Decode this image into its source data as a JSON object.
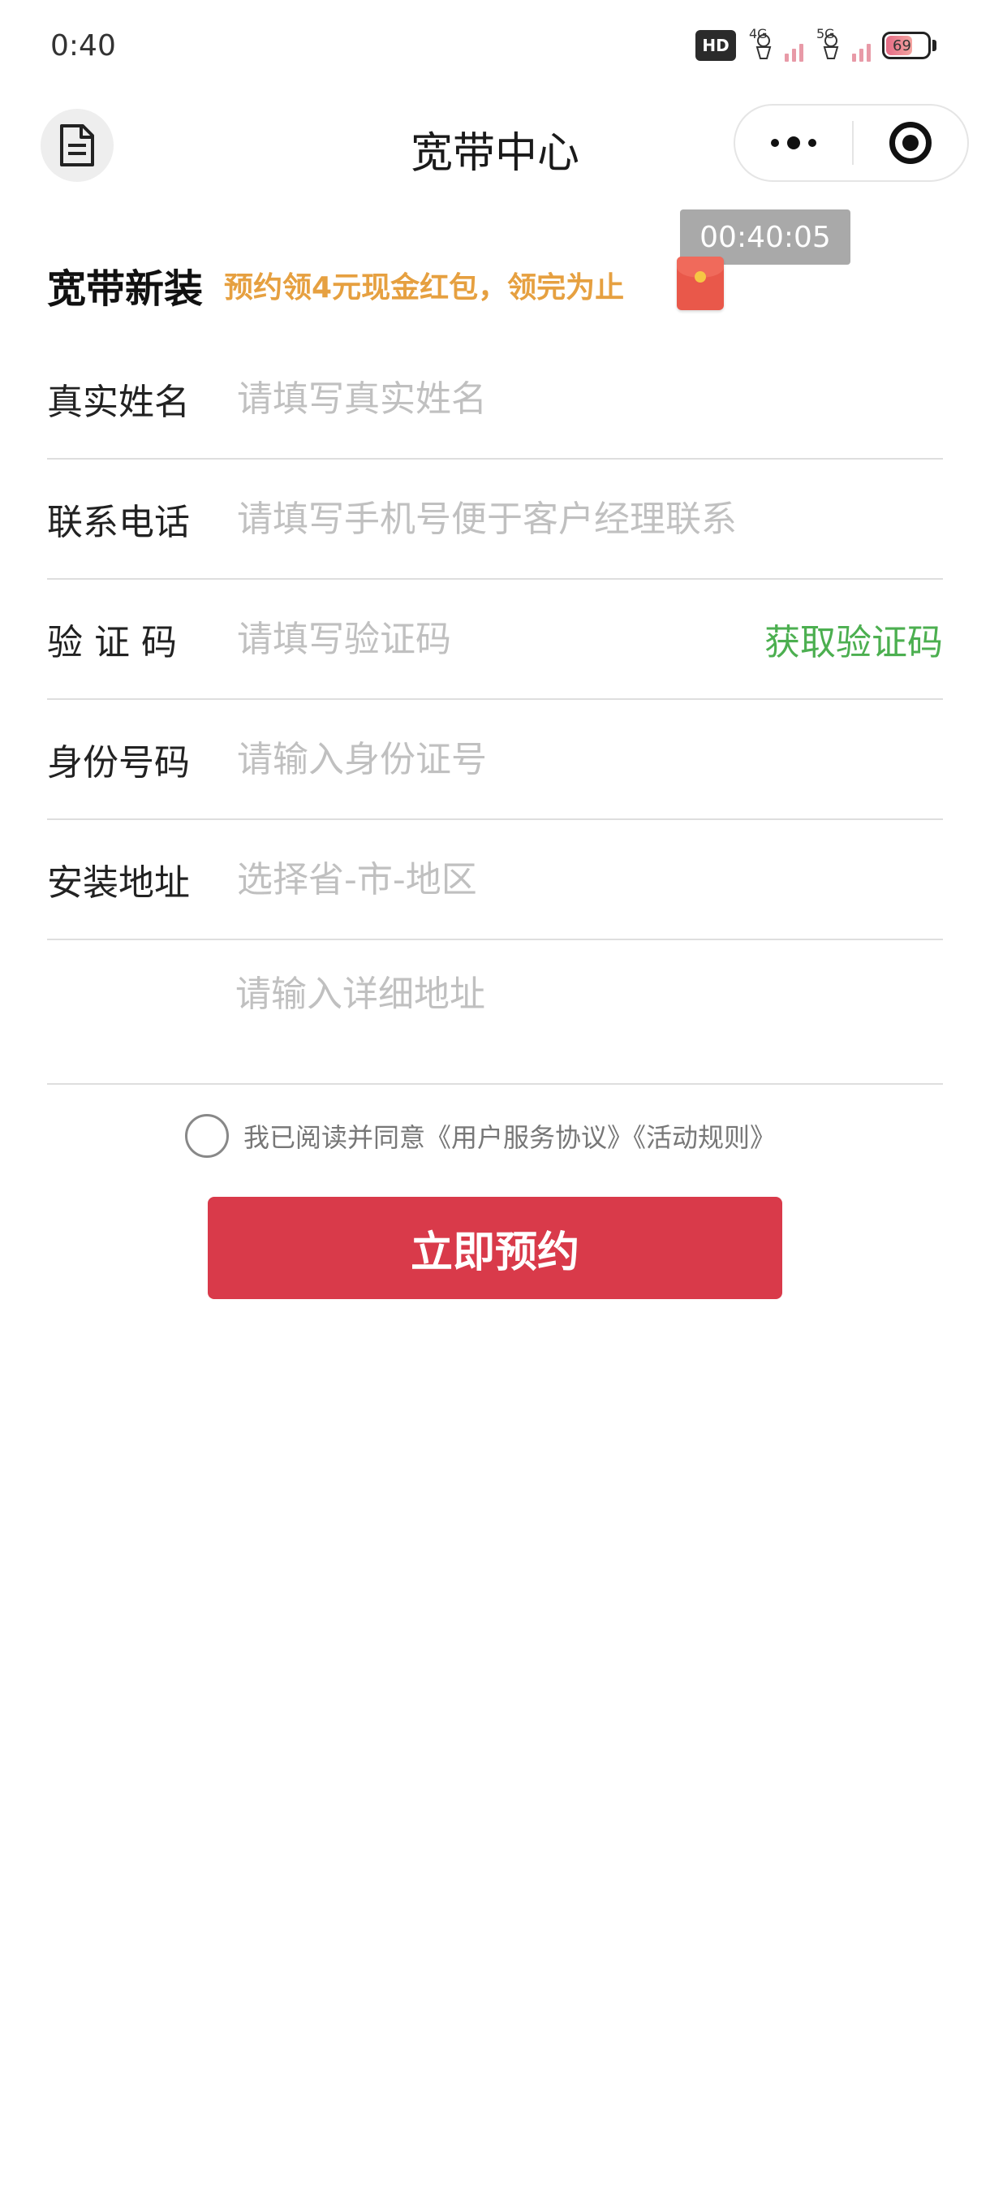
{
  "status_bar": {
    "time": "0:40",
    "hd_label": "HD",
    "network_1": "4G",
    "network_2": "5G",
    "battery": "69"
  },
  "nav": {
    "title": "宽带中心"
  },
  "timer": "00:40:05",
  "banner": {
    "title": "宽带新装",
    "promo": "预约领4元现金红包，领完为止"
  },
  "form": {
    "name": {
      "label": "真实姓名",
      "placeholder": "请填写真实姓名",
      "value": ""
    },
    "phone": {
      "label": "联系电话",
      "placeholder": "请填写手机号便于客户经理联系",
      "value": ""
    },
    "code": {
      "label": "验 证 码",
      "placeholder": "请填写验证码",
      "value": "",
      "action": "获取验证码"
    },
    "id_number": {
      "label": "身份号码",
      "placeholder": "请输入身份证号",
      "value": ""
    },
    "address": {
      "label": "安装地址",
      "placeholder": "选择省-市-地区",
      "value": ""
    },
    "address_detail": {
      "placeholder": "请输入详细地址",
      "value": ""
    }
  },
  "agreement": {
    "text": "我已阅读并同意《用户服务协议》《活动规则》",
    "checked": false
  },
  "submit_label": "立即预约",
  "colors": {
    "accent_red": "#d93a4a",
    "promo_orange": "#e6a040",
    "code_green": "#4caf50"
  }
}
